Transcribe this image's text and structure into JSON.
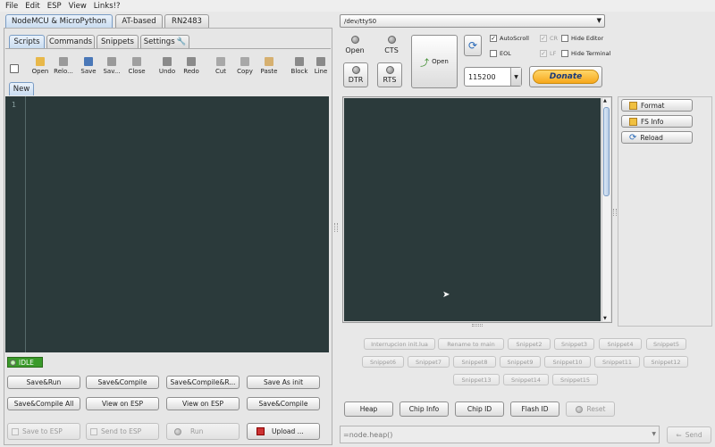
{
  "menu": [
    "File",
    "Edit",
    "ESP",
    "View",
    "Links!?"
  ],
  "top_tabs": [
    "NodeMCU & MicroPython",
    "AT-based",
    "RN2483"
  ],
  "sub_tabs": [
    "Scripts",
    "Commands",
    "Snippets",
    "Settings"
  ],
  "toolbar": [
    "Open",
    "Relo...",
    "Save",
    "Sav...",
    "Close",
    "Undo",
    "Redo",
    "Cut",
    "Copy",
    "Paste",
    "Block",
    "Line"
  ],
  "file_tab": "New",
  "editor": {
    "line_number": "1"
  },
  "status": "IDLE",
  "script_buttons": [
    [
      "Save&Run",
      "Save&Compile",
      "Save&Compile&R...",
      "Save As init"
    ],
    [
      "Save&Compile All",
      "View on ESP",
      "View on ESP",
      "Save&Compile"
    ]
  ],
  "bottom_buttons": {
    "save_to_esp": "Save to ESP",
    "send_to_esp": "Send to ESP",
    "run": "Run",
    "upload": "Upload ..."
  },
  "port": "/dev/ttyS0",
  "connection": {
    "open_label": "Open",
    "cts_label": "CTS",
    "dtr_label": "DTR",
    "rts_label": "RTS",
    "open_button": "Open",
    "baud": "115200",
    "donate": "Donate"
  },
  "options": {
    "autoscroll": "AutoScroll",
    "cr": "CR",
    "hide_editor": "Hide Editor",
    "eol": "EOL",
    "lf": "LF",
    "hide_terminal": "Hide Terminal"
  },
  "side_buttons": [
    "Format",
    "FS Info",
    "Reload"
  ],
  "snippets": [
    [
      "Interrupcion init.lua",
      "Rename to main",
      "Snippet2",
      "Snippet3",
      "Snippet4",
      "Snippet5"
    ],
    [
      "Snippet6",
      "Snippet7",
      "Snippet8",
      "Snippet9",
      "Snippet10",
      "Snippet11",
      "Snippet12"
    ],
    [
      "Snippet13",
      "Snippet14",
      "Snippet15"
    ]
  ],
  "info_buttons": [
    "Heap",
    "Chip Info",
    "Chip ID",
    "Flash ID",
    "Reset"
  ],
  "command_input": "=node.heap()",
  "send_button": "Send",
  "colors": {
    "terminal_bg": "#2b3a3b",
    "idle_green": "#3a9a2a",
    "donate_bg": "#f7b52c",
    "tab_active": "#c9dcf0"
  }
}
